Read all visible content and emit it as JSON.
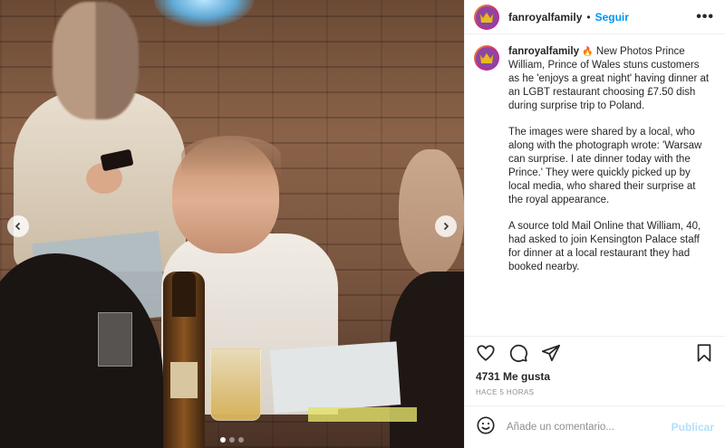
{
  "post": {
    "username": "fanroyalfamily",
    "separator": "•",
    "follow_label": "Seguir",
    "more_label": "•••",
    "caption": {
      "username": "fanroyalfamily",
      "emoji": "🔥",
      "paragraph1": "New Photos Prince William, Prince of Wales stuns customers as he 'enjoys a great night' having dinner at an LGBT restaurant choosing £7.50 dish during surprise trip to Poland.",
      "paragraph2": "The images were shared by a local, who along with the photograph wrote: 'Warsaw can surprise. I ate dinner today with the Prince.' They were quickly picked up by local media, who shared their surprise at the royal appearance.",
      "paragraph3": "A source told Mail Online that William, 40, had asked to join Kensington Palace staff for dinner at a local restaurant they had booked nearby."
    },
    "likes": "4731 Me gusta",
    "time": "HACE 5 HORAS",
    "comment_placeholder": "Añade un comentario...",
    "publish_label": "Publicar",
    "carousel": {
      "slides": 3,
      "active_index": 0
    },
    "icons": [
      "heart-icon",
      "comment-icon",
      "share-icon",
      "bookmark-icon",
      "emoji-icon",
      "crown-icon"
    ]
  }
}
